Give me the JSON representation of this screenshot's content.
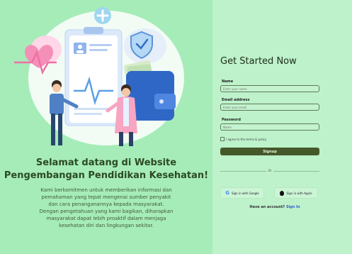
{
  "left": {
    "headline_line1": "Selamat datang di Website",
    "headline_line2": "Pengembangan Pendidikan Kesehatan!",
    "description_lines": [
      "Kami berkomitmen untuk memberikan informasi dan",
      "pemahaman yang tepat mengenai sumber penyakit",
      "dan cara penanganannya kepada masyarakat.",
      "Dengan pengetahuan yang kami bagikan, diharapkan",
      "masyarakat dapat lebih proaktif dalam menjaga",
      "kesehatan diri dan lingkungan sekitar."
    ]
  },
  "form": {
    "title": "Get Started Now",
    "name_label": "Name",
    "name_placeholder": "Enter your name",
    "email_label": "Email address",
    "email_placeholder": "Enter your email",
    "password_label": "Password",
    "password_placeholder": "Name",
    "terms_text": "I agree to the terms & policy",
    "signup_label": "Signup",
    "or_text": "Or",
    "google_label": "Sign in with Google",
    "apple_label": "Sign in with Apple",
    "have_account_text": "Have an account?",
    "signin_link": "Sign In"
  },
  "colors": {
    "left_bg": "#a6ecb9",
    "right_bg": "#bdf2ca",
    "accent_dark": "#45582a",
    "link": "#2d5bd6"
  },
  "icons": [
    "plus-badge-icon",
    "shield-check-icon",
    "heartbeat-icon",
    "wallet-icon",
    "google-icon",
    "apple-icon"
  ]
}
